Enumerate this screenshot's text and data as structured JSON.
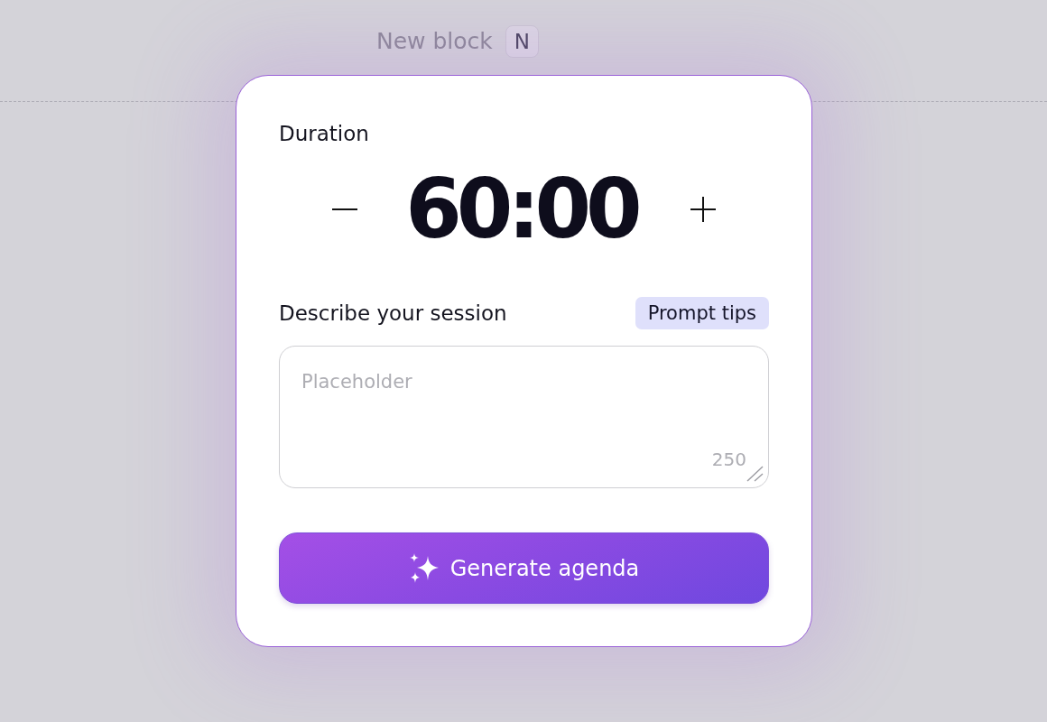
{
  "block_header": {
    "title": "New block",
    "shortcut": "N"
  },
  "card": {
    "duration": {
      "label": "Duration",
      "value": "60:00"
    },
    "description": {
      "label": "Describe your session",
      "tips_button": "Prompt tips",
      "placeholder": "Placeholder",
      "char_count": "250"
    },
    "generate_button": {
      "label": "Generate agenda"
    }
  }
}
